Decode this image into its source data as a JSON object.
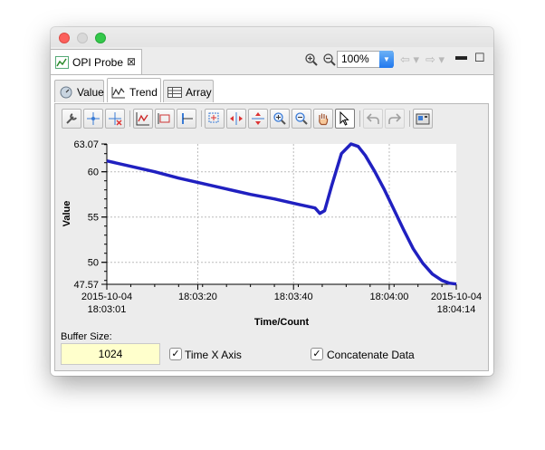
{
  "window": {
    "view_tab": "OPI Probe",
    "zoom": "100%",
    "subtabs": [
      {
        "label": "Value",
        "icon": "dial-icon"
      },
      {
        "label": "Trend",
        "icon": "trend-chart-icon"
      },
      {
        "label": "Array",
        "icon": "table-icon"
      }
    ],
    "active_subtab": "Trend"
  },
  "chart_data": {
    "type": "line",
    "xlabel": "Time/Count",
    "ylabel": "Value",
    "ylim": [
      47.57,
      63.07
    ],
    "y_ticks": [
      "63.07",
      "60",
      "55",
      "50",
      "47.57"
    ],
    "x_ticks": [
      {
        "top": "2015-10-04",
        "bottom": "18:03:01"
      },
      {
        "top": "18:03:20",
        "bottom": ""
      },
      {
        "top": "18:03:40",
        "bottom": ""
      },
      {
        "top": "18:04:00",
        "bottom": ""
      },
      {
        "top": "2015-10-04",
        "bottom": "18:04:14"
      }
    ],
    "x_tick_seconds": [
      0,
      19,
      39,
      59,
      73
    ],
    "grid": true,
    "series": [
      {
        "color": "#2020c0",
        "x": [
          0,
          5,
          10,
          15,
          20,
          25,
          30,
          35,
          40,
          43.5,
          44.5,
          45.5,
          47,
          49,
          51,
          52.5,
          54,
          56,
          58,
          60,
          62,
          64,
          66,
          68,
          70,
          71.5,
          73
        ],
        "y": [
          61.2,
          60.6,
          60.0,
          59.3,
          58.7,
          58.1,
          57.5,
          57.0,
          56.4,
          56.0,
          55.4,
          55.7,
          58.5,
          62.0,
          63.07,
          62.8,
          61.8,
          60.0,
          58.0,
          55.8,
          53.6,
          51.5,
          49.9,
          48.7,
          48.0,
          47.7,
          47.6
        ]
      }
    ]
  },
  "buffer": {
    "label": "Buffer Size:",
    "value": "1024"
  },
  "options": [
    {
      "label": "Time X Axis",
      "checked": true
    },
    {
      "label": "Concatenate Data",
      "checked": true
    }
  ],
  "colors": {
    "trace": "#2020c0",
    "buffer_bg": "#ffffcc",
    "zoom_btn": "#2178ee"
  }
}
